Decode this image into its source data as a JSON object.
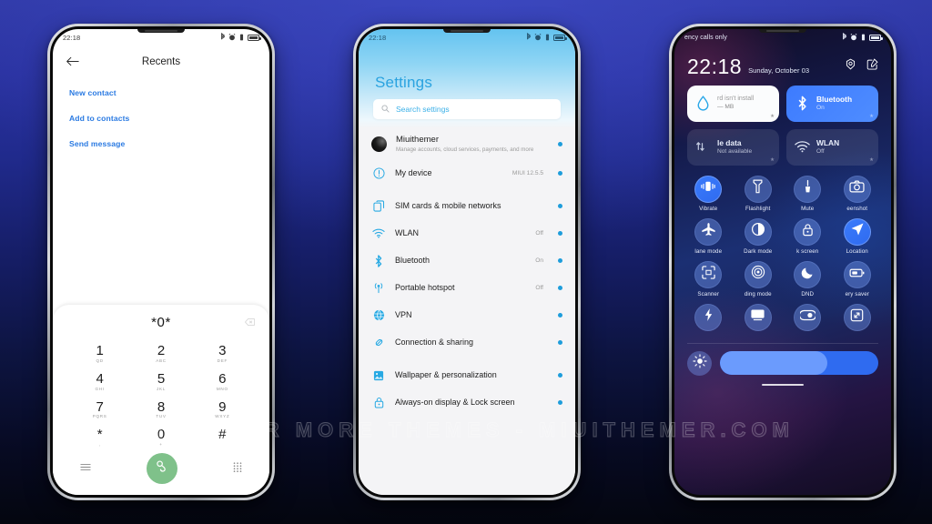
{
  "watermark": "VISIT FOR MORE THEMES  -  MIUITHEMER.COM",
  "phone1": {
    "statusbar": {
      "time": "22:18"
    },
    "header": {
      "back_icon": "back-arrow-icon",
      "title": "Recents"
    },
    "actions": [
      {
        "label": "New contact"
      },
      {
        "label": "Add to contacts"
      },
      {
        "label": "Send message"
      }
    ],
    "dialer": {
      "number": "*0*",
      "delete_icon": "backspace-icon",
      "keys": [
        {
          "digit": "1",
          "letters": "QD"
        },
        {
          "digit": "2",
          "letters": "ABC"
        },
        {
          "digit": "3",
          "letters": "DEF"
        },
        {
          "digit": "4",
          "letters": "GHI"
        },
        {
          "digit": "5",
          "letters": "JKL"
        },
        {
          "digit": "6",
          "letters": "MNO"
        },
        {
          "digit": "7",
          "letters": "PQRS"
        },
        {
          "digit": "8",
          "letters": "TUV"
        },
        {
          "digit": "9",
          "letters": "WXYZ"
        },
        {
          "digit": "*",
          "letters": ","
        },
        {
          "digit": "0",
          "letters": "+"
        },
        {
          "digit": "#",
          "letters": ""
        }
      ],
      "left_icon": "menu-lines-icon",
      "call_icon": "call-icon",
      "right_icon": "keypad-grid-icon",
      "call_button_color": "#7fc18a"
    }
  },
  "phone2": {
    "statusbar": {
      "time": "22:18"
    },
    "title": "Settings",
    "search": {
      "placeholder": "Search settings",
      "icon": "search-icon"
    },
    "account": {
      "name": "Miuithemer",
      "subtitle": "Manage accounts, cloud services, payments, and more"
    },
    "items": [
      {
        "label": "My device",
        "value": "MIUI 12.5.5",
        "icon": "info-circle-icon"
      },
      {
        "label": "SIM cards & mobile networks",
        "value": "",
        "icon": "sim-cards-icon"
      },
      {
        "label": "WLAN",
        "value": "Off",
        "icon": "wifi-icon"
      },
      {
        "label": "Bluetooth",
        "value": "On",
        "icon": "bluetooth-icon"
      },
      {
        "label": "Portable hotspot",
        "value": "Off",
        "icon": "hotspot-icon"
      },
      {
        "label": "VPN",
        "value": "",
        "icon": "globe-vpn-icon"
      },
      {
        "label": "Connection & sharing",
        "value": "",
        "icon": "link-sharing-icon"
      },
      {
        "label": "Wallpaper & personalization",
        "value": "",
        "icon": "wallpaper-icon"
      },
      {
        "label": "Always-on display & Lock screen",
        "value": "",
        "icon": "lock-icon"
      }
    ],
    "accent_color": "#27a9e3"
  },
  "phone3": {
    "statusbar": {
      "carrier": "ency calls only"
    },
    "clock": {
      "time": "22:18",
      "date": "Sunday, October 03"
    },
    "header_icons": [
      {
        "name": "settings-gear-icon"
      },
      {
        "name": "edit-icon"
      }
    ],
    "big_tiles": [
      {
        "title": "rd isn't install",
        "subtitle": "— MB",
        "state": "light",
        "icon": "water-drop-icon"
      },
      {
        "title": "Bluetooth",
        "subtitle": "On",
        "state": "on",
        "icon": "bluetooth-icon"
      },
      {
        "title": "le data",
        "subtitle": "Not available",
        "state": "off",
        "icon": "mobile-data-icon"
      },
      {
        "title": "WLAN",
        "subtitle": "Off",
        "state": "off",
        "icon": "wifi-icon"
      }
    ],
    "toggles": [
      {
        "label": "Vibrate",
        "icon": "vibrate-icon",
        "active": true
      },
      {
        "label": "Flashlight",
        "icon": "flashlight-icon",
        "active": false
      },
      {
        "label": "Mute",
        "icon": "mute-bell-icon",
        "active": false
      },
      {
        "label": "eenshot",
        "icon": "screenshot-camera-icon",
        "active": false
      },
      {
        "label": "lane mode",
        "icon": "airplane-icon",
        "active": false
      },
      {
        "label": "Dark mode",
        "icon": "dark-mode-icon",
        "active": false
      },
      {
        "label": "k screen",
        "icon": "lock-screen-icon",
        "active": false
      },
      {
        "label": "Location",
        "icon": "location-arrow-icon",
        "active": true
      },
      {
        "label": "Scanner",
        "icon": "scanner-frame-icon",
        "active": false
      },
      {
        "label": "ding mode",
        "icon": "reading-mode-icon",
        "active": false
      },
      {
        "label": "DND",
        "icon": "moon-dnd-icon",
        "active": false
      },
      {
        "label": "ery saver",
        "icon": "battery-saver-icon",
        "active": false
      },
      {
        "label": "",
        "icon": "quick-charge-icon",
        "active": false
      },
      {
        "label": "",
        "icon": "cast-screen-icon",
        "active": false
      },
      {
        "label": "",
        "icon": "sync-toggle-icon",
        "active": false
      },
      {
        "label": "",
        "icon": "screen-rotate-icon",
        "active": false
      }
    ],
    "brightness": {
      "icon": "brightness-icon",
      "value_percent": 68
    },
    "accent_color": "#3d7bff"
  }
}
